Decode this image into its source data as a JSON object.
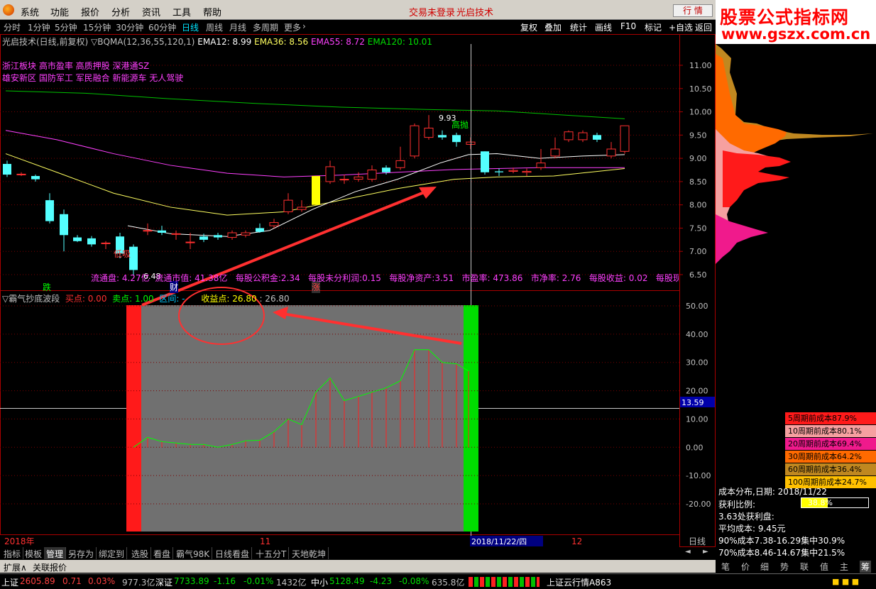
{
  "menubar": {
    "items": [
      "系统",
      "功能",
      "报价",
      "分析",
      "资讯",
      "工具",
      "帮助"
    ],
    "status": "交易未登录",
    "stock_title": "光启技术",
    "mode_button": "行  情",
    "watermark_title": "股票公式指标网",
    "watermark_url": "www.gszx.com.cn"
  },
  "tabs": {
    "periods": [
      "分时",
      "1分钟",
      "5分钟",
      "15分钟",
      "30分钟",
      "60分钟",
      "日线",
      "周线",
      "月线",
      "多周期",
      "更多"
    ],
    "active_period": "日线",
    "right_buttons": [
      "复权",
      "叠加",
      "统计",
      "画线",
      "F10",
      "标记",
      "+自选",
      "返回"
    ]
  },
  "main_chart": {
    "title": "光启技术(日线,前复权)",
    "indicator": "▽BQMA(12,36,55,120,1)",
    "ema12": "EMA12: 8.99",
    "ema36": "EMA36: 8.56",
    "ema55": "EMA55: 8.72",
    "ema120": "EMA120: 10.01",
    "tags_line1": "浙江板块 高市盈率 高质押股 深港通SZ",
    "tags_line2": "雄安新区 国防军工 军民融合 新能源车 无人驾驶",
    "high_label": "9.93",
    "high_note": "高抛",
    "low_note": "低吸",
    "low_label": "6.48",
    "die_label": "跌",
    "cai_label": "财",
    "zhang_label": "涨",
    "fundamentals": [
      "流通盘: 4.27亿",
      "流通市值: 41.38亿",
      "每股公积金:2.34",
      "每股未分利润:0.15",
      "每股净资产:3.51",
      "市盈率: 473.86",
      "市净率: 2.76",
      "每股收益: 0.02",
      "每股现金"
    ],
    "price_axis": [
      "11.00",
      "10.50",
      "10.00",
      "9.50",
      "9.00",
      "8.50",
      "8.00",
      "7.50",
      "7.00",
      "6.50"
    ]
  },
  "sub_chart": {
    "title": "▽霸气抄底波段",
    "buy_label": "买点: 0.00",
    "sell_label": "卖点: 1.00",
    "range_label": "区间: -",
    "profit_label": "收益点: 26.80",
    "profit_value": ": 26.80",
    "axis": [
      "50.00",
      "40.00",
      "30.00",
      "20.00",
      "10.00",
      "0.00",
      "-10.00",
      "-20.00"
    ],
    "cursor_value": "13.59"
  },
  "time_axis": {
    "year": "2018年",
    "month11": "11",
    "cursor_date": "2018/11/22/四",
    "month12": "12",
    "period_label": "日线"
  },
  "bottom_tabs": [
    "指标",
    "模板",
    "管理",
    "另存为",
    "绑定到",
    "选股",
    "看盘",
    "霸气98K",
    "日线看盘",
    "十五分T",
    "天地乾坤"
  ],
  "active_bottom_tab": "管理",
  "expand_row": [
    "扩展∧",
    "关联报价"
  ],
  "cost_panel": {
    "rows": [
      {
        "label": "5周期前成本87.9%",
        "color": "#ff1a1a"
      },
      {
        "label": "10周期前成本80.1%",
        "color": "#f6a0a0"
      },
      {
        "label": "20周期前成本69.4%",
        "color": "#f01a8c"
      },
      {
        "label": "30周期前成本64.2%",
        "color": "#ff6a00"
      },
      {
        "label": "60周期前成本36.4%",
        "color": "#c08820"
      },
      {
        "label": "100周期前成本24.7%",
        "color": "#ffc000"
      }
    ],
    "dist_date": "成本分布,日期:  2018/11/22",
    "profit_ratio_label": "获利比例:",
    "profit_ratio_value": "38.8%",
    "profit_point": "3.63处获利盘:",
    "avg_cost": "平均成本:  9.45元",
    "cost90": "90%成本7.38-16.29集中30.9%",
    "cost70": "70%成本8.46-14.67集中21.5%",
    "buttons": [
      "笔",
      "价",
      "细",
      "势",
      "联",
      "值",
      "主",
      "筹"
    ]
  },
  "statusbar": {
    "sh_name": "上证",
    "sh_value": "2605.89",
    "sh_change": "0.71",
    "sh_pct": "0.03%",
    "sh_amount": "977.3亿",
    "sz_name": "深证",
    "sz_value": "7733.89",
    "sz_change": "-1.16",
    "sz_pct": "-0.01%",
    "sz_amount": "1432亿",
    "zx_name": "中小",
    "zx_value": "5128.49",
    "zx_change": "-4.23",
    "zx_pct": "-0.08%",
    "zx_amount": "635.8亿",
    "cloud": "上证云行情A863"
  },
  "colors": {
    "up": "#ff3030",
    "down": "#54ffff",
    "ema12": "#ffffff",
    "ema36": "#ffff60",
    "ema55": "#ff40ff",
    "ema120": "#00c000"
  }
}
